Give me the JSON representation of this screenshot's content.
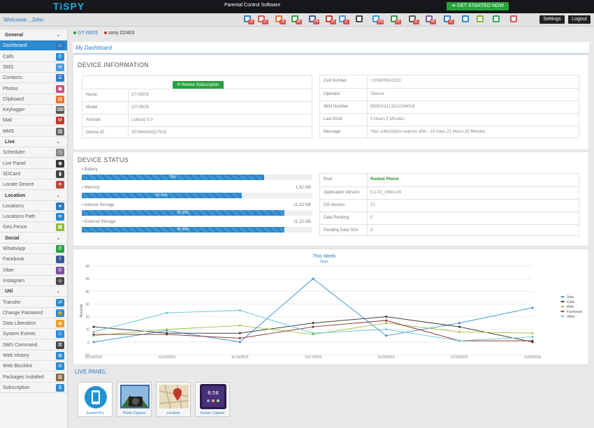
{
  "header": {
    "logo": "TiSPY",
    "subtitle": "Parental Control Software",
    "start_button": "GET STARTED NOW",
    "welcome": "Welcome , John",
    "settings": "Settings",
    "logout": "Logout",
    "notifications": [
      {
        "icon": "calls-icon",
        "color": "#2b7fc3",
        "count": "12"
      },
      {
        "icon": "sms-icon",
        "color": "#d9534f",
        "count": "21"
      },
      {
        "icon": "contacts-icon",
        "color": "#e8732a",
        "count": "19"
      },
      {
        "icon": "whatsapp-icon",
        "color": "#25a244",
        "count": "36"
      },
      {
        "icon": "facebook-icon",
        "color": "#3b5998",
        "count": "24"
      },
      {
        "icon": "mail-icon",
        "color": "#c0392b",
        "count": "19"
      },
      {
        "icon": "photos-icon",
        "color": "#4a90d9",
        "count": "6"
      },
      {
        "icon": "keylogger-icon",
        "color": "#444444",
        "count": ""
      },
      {
        "icon": "skype-icon",
        "color": "#2a9fd6",
        "count": "100"
      },
      {
        "icon": "hangouts-icon",
        "color": "#2e9b46",
        "count": "20"
      },
      {
        "icon": "browser-icon",
        "color": "#555555",
        "count": "11"
      },
      {
        "icon": "viber-icon",
        "color": "#7b519d",
        "count": "45"
      },
      {
        "icon": "web-icon",
        "color": "#2b7fc3",
        "count": "31"
      },
      {
        "icon": "subscription-icon",
        "color": "#1e8fc9",
        "count": ""
      },
      {
        "icon": "android-icon",
        "color": "#8bb93a",
        "count": ""
      },
      {
        "icon": "location-icon",
        "color": "#3aa655",
        "count": ""
      },
      {
        "icon": "video-icon",
        "color": "#d9534f",
        "count": ""
      }
    ]
  },
  "sidebar": {
    "items": [
      {
        "label": "General",
        "type": "head"
      },
      {
        "label": "Dashboard",
        "icon": "home-icon",
        "color": "#2c7bc4",
        "active": true
      },
      {
        "label": "Calls",
        "icon": "phone-icon",
        "color": "#2c8ad0"
      },
      {
        "label": "SMS",
        "icon": "sms-icon",
        "color": "#4a9ad9"
      },
      {
        "label": "Contacts",
        "icon": "contacts-icon",
        "color": "#2c7bc4"
      },
      {
        "label": "Photos",
        "icon": "photos-icon",
        "color": "#c0507a"
      },
      {
        "label": "Clipboard",
        "icon": "clipboard-icon",
        "color": "#e8732a"
      },
      {
        "label": "Keylogger",
        "icon": "keyboard-icon",
        "color": "#555555"
      },
      {
        "label": "Mail",
        "icon": "mail-icon",
        "color": "#c0392b"
      },
      {
        "label": "MMS",
        "icon": "mms-icon",
        "color": "#666666"
      },
      {
        "label": "Live",
        "type": "head"
      },
      {
        "label": "Scheduler",
        "icon": "clock-icon",
        "color": "#888888"
      },
      {
        "label": "Live Panel",
        "icon": "camera-icon",
        "color": "#333333"
      },
      {
        "label": "SDCard",
        "icon": "sdcard-icon",
        "color": "#444444"
      },
      {
        "label": "Locate Device",
        "icon": "map-icon",
        "color": "#c04a3a"
      },
      {
        "label": "Location",
        "type": "head"
      },
      {
        "label": "Locations",
        "icon": "pin-icon",
        "color": "#2c7bc4"
      },
      {
        "label": "Locations Path",
        "icon": "path-icon",
        "color": "#2c8ad0"
      },
      {
        "label": "Geo Fence",
        "icon": "fence-icon",
        "color": "#8bb93a"
      },
      {
        "label": "Social",
        "type": "head"
      },
      {
        "label": "WhatsApp",
        "icon": "whatsapp-icon",
        "color": "#25a244"
      },
      {
        "label": "Facebook",
        "icon": "facebook-icon",
        "color": "#3b5998"
      },
      {
        "label": "Viber",
        "icon": "viber-icon",
        "color": "#7b519d"
      },
      {
        "label": "Instagram",
        "icon": "instagram-icon",
        "color": "#444444"
      },
      {
        "label": "Util",
        "type": "head"
      },
      {
        "label": "Transfer",
        "icon": "transfer-icon",
        "color": "#2c8ad0"
      },
      {
        "label": "Change Password",
        "icon": "lock-icon",
        "color": "#2c8ad0"
      },
      {
        "label": "Data Liberation",
        "icon": "globe-icon",
        "color": "#e8a02a"
      },
      {
        "label": "System Events",
        "icon": "events-icon",
        "color": "#2c8ad0"
      },
      {
        "label": "SMS Command",
        "icon": "command-icon",
        "color": "#444444"
      },
      {
        "label": "Web History",
        "icon": "web-history-icon",
        "color": "#2c8ad0"
      },
      {
        "label": "Web Blocklist",
        "icon": "web-block-icon",
        "color": "#2c8ad0"
      },
      {
        "label": "Packages Installed",
        "icon": "package-icon",
        "color": "#8b6a3a"
      },
      {
        "label": "Subscription",
        "icon": "dollar-icon",
        "color": "#2c8ad0"
      }
    ]
  },
  "tabs": [
    {
      "label": "GT-I9505",
      "dot": "#27a33c",
      "active": true
    },
    {
      "label": "sony D2403",
      "dot": "#c0392b",
      "active": false
    }
  ],
  "dashboard_title": "My Dashboard",
  "device_info": {
    "title": "DEVICE INFORMATION",
    "renew": "Renew Subscription",
    "left": [
      {
        "k": "Name",
        "v": "GT-I9505"
      },
      {
        "k": "Model",
        "v": "GT-I9505"
      },
      {
        "k": "Android",
        "v": "Lollipop 5.0"
      },
      {
        "k": "Device ID",
        "v": "357660060327915"
      }
    ],
    "right": [
      {
        "k": "Cell Number",
        "v": "+109876543210"
      },
      {
        "k": "Operator",
        "v": "Telenor"
      },
      {
        "k": "IMSI Number",
        "v": "850610112101224601B"
      },
      {
        "k": "Last Ponit",
        "v": "0 Hours,5 Minutes"
      },
      {
        "k": "Message",
        "v": "Your subscription expires after : 19 Days,21 Hours,33 Minutes"
      }
    ]
  },
  "device_status": {
    "title": "DEVICE STATUS",
    "bars": [
      {
        "label": "Battery",
        "cap": "",
        "pct": 79,
        "text": "79%"
      },
      {
        "label": "Memory",
        "cap": "1.82 GB",
        "pct": 69.41,
        "text": "69.41%"
      },
      {
        "label": "Internal Storage",
        "cap": "11.23 GB",
        "pct": 87.99,
        "text": "87.99%"
      },
      {
        "label": "External Storage",
        "cap": "11.23 GB",
        "pct": 87.99,
        "text": "87.99%"
      }
    ],
    "right": [
      {
        "k": "Root",
        "v": "Rooted Phone",
        "green": true
      },
      {
        "k": "Application Version",
        "v": "5.1.02_16Nov15"
      },
      {
        "k": "OS Version",
        "v": "21"
      },
      {
        "k": "Data Pending",
        "v": "0"
      },
      {
        "k": "Pending Data Size",
        "v": "0"
      }
    ]
  },
  "chart_data": {
    "type": "line",
    "title": "This Week",
    "subtitle": "Days",
    "xlabel": "",
    "ylabel": "Records",
    "categories": [
      "11/14/2015",
      "11/15/2015",
      "11/16/2015",
      "11/17/2015",
      "11/18/2015",
      "11/19/2015",
      "11/20/2015"
    ],
    "ylim": [
      -10,
      60
    ],
    "yticks": [
      -10,
      0,
      10,
      20,
      30,
      40,
      50,
      60
    ],
    "legend": "right",
    "series": [
      {
        "name": "Sms",
        "color": "#2f8fd0",
        "values": [
          0,
          9,
          0,
          50,
          5,
          15,
          27
        ]
      },
      {
        "name": "Calls",
        "color": "#2b2b2b",
        "values": [
          12,
          7,
          7,
          15,
          20,
          12,
          0
        ]
      },
      {
        "name": "Web",
        "color": "#9bc13c",
        "values": [
          5,
          10,
          13,
          6,
          15,
          8,
          7
        ]
      },
      {
        "name": "Facebook",
        "color": "#8b2a2a",
        "values": [
          6,
          6,
          3,
          12,
          17,
          1,
          1
        ]
      },
      {
        "name": "Viber",
        "color": "#5fc0d6",
        "values": [
          8,
          23,
          25,
          7,
          10,
          1,
          4
        ]
      }
    ]
  },
  "live_panel": {
    "title": "LIVE PANEL",
    "items": [
      {
        "label": "Screen-Pro",
        "icon": "screen-pro-icon"
      },
      {
        "label": "Photo Capture",
        "icon": "photo-capture-icon"
      },
      {
        "label": "Location",
        "icon": "location-map-icon"
      },
      {
        "label": "Screen Capture",
        "icon": "screen-capture-icon"
      }
    ]
  }
}
